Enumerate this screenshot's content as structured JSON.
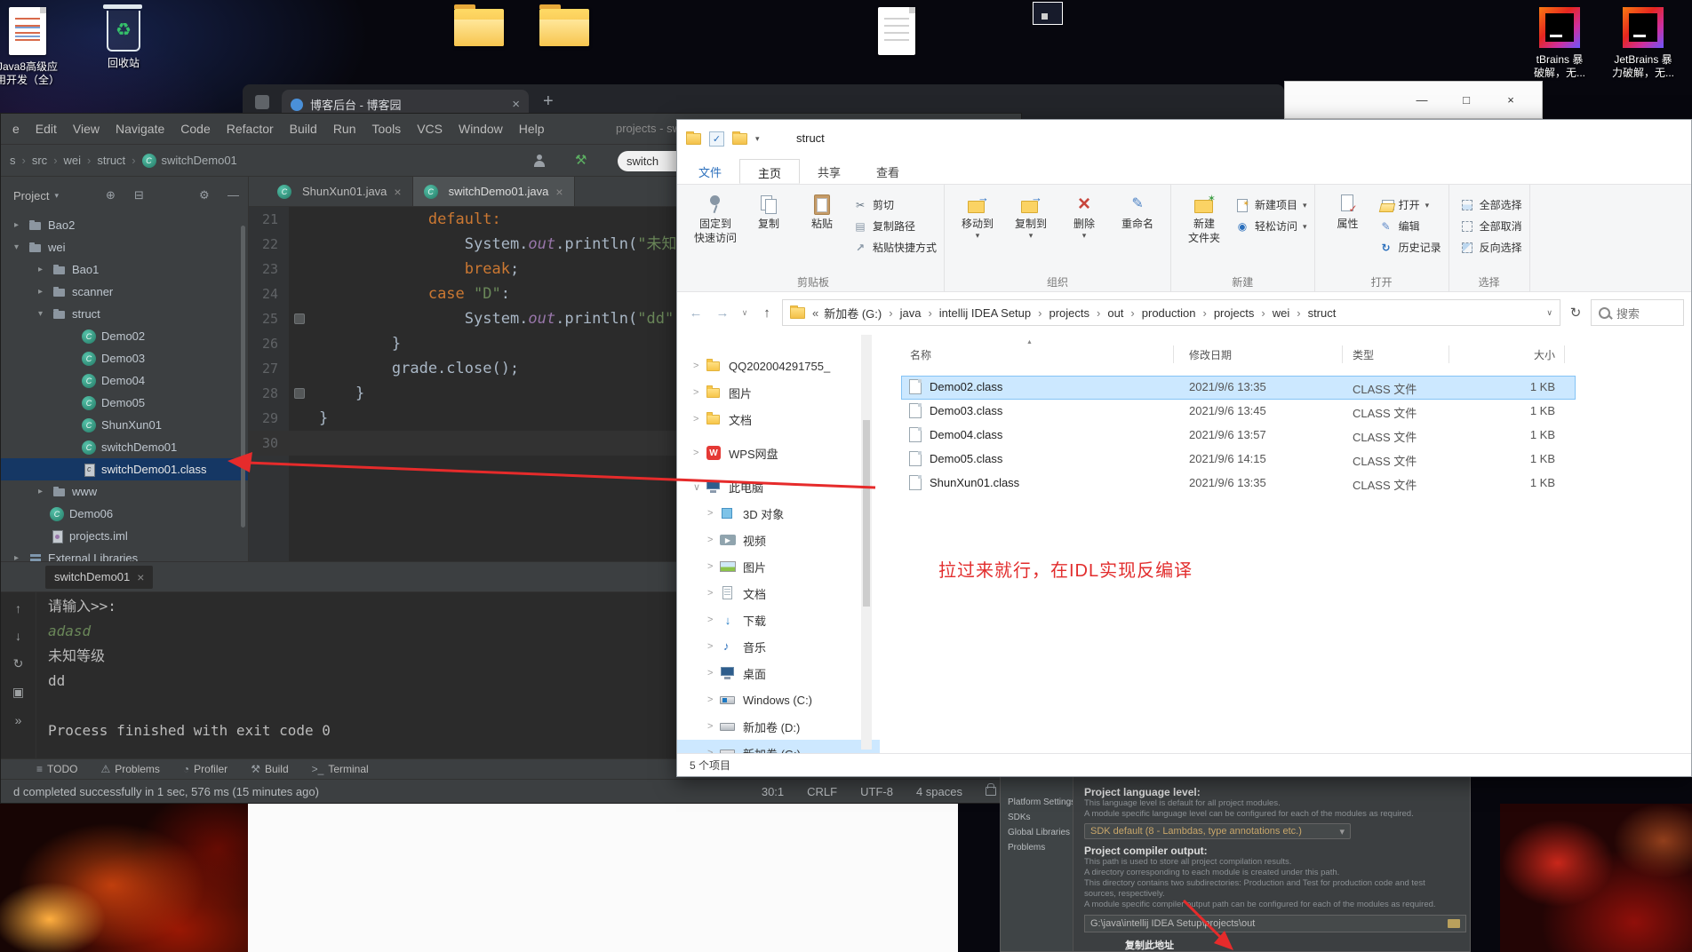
{
  "desktop": {
    "icon_java8": {
      "line1": "Java8高级应",
      "line2": "用开发（全）"
    },
    "recycle_label": "回收站",
    "jb1": {
      "line1": "tBrains 暴",
      "line2": "破解，无..."
    },
    "jb2": {
      "line1": "JetBrains 暴",
      "line2": "力破解，无..."
    }
  },
  "browser": {
    "tab_title": "博客后台 - 博客园",
    "close": "×",
    "new_tab": "+"
  },
  "bg_window": {
    "min": "—",
    "max": "□",
    "close": "×"
  },
  "idea": {
    "menu": [
      "e",
      "Edit",
      "View",
      "Navigate",
      "Code",
      "Refactor",
      "Build",
      "Run",
      "Tools",
      "VCS",
      "Window",
      "Help"
    ],
    "title": "projects - sw",
    "breadcrumbs": [
      {
        "t": "s"
      },
      {
        "t": "src"
      },
      {
        "t": "wei"
      },
      {
        "t": "struct"
      },
      {
        "t": "switchDemo01",
        "icon": true
      }
    ],
    "run_config": "switch",
    "project_label": "Project",
    "project_caret": "▾",
    "panel_icons": [
      "⊕",
      "⊟",
      "⚙",
      "—"
    ],
    "tree": [
      {
        "label": "Bao2",
        "cls": "lvl1",
        "chev": "▸",
        "icon": "folder"
      },
      {
        "label": "wei",
        "cls": "lvl1",
        "chev": "▾",
        "icon": "folder"
      },
      {
        "label": "Bao1",
        "cls": "lvl2",
        "chev": "▸",
        "icon": "folder"
      },
      {
        "label": "scanner",
        "cls": "lvl2",
        "chev": "▸",
        "icon": "folder"
      },
      {
        "label": "struct",
        "cls": "lvl2",
        "chev": "▾",
        "icon": "folder"
      },
      {
        "label": "Demo02",
        "cls": "lvl3",
        "icon": "class"
      },
      {
        "label": "Demo03",
        "cls": "lvl3",
        "icon": "class"
      },
      {
        "label": "Demo04",
        "cls": "lvl3",
        "icon": "class"
      },
      {
        "label": "Demo05",
        "cls": "lvl3",
        "icon": "class"
      },
      {
        "label": "ShunXun01",
        "cls": "lvl3",
        "icon": "class"
      },
      {
        "label": "switchDemo01",
        "cls": "lvl3",
        "icon": "class"
      },
      {
        "label": "switchDemo01.class",
        "cls": "lvl3 selected",
        "icon": "classfile"
      },
      {
        "label": "www",
        "cls": "lvl2",
        "chev": "▸",
        "icon": "folder"
      },
      {
        "label": "Demo06",
        "cls": "lvl1b",
        "icon": "class"
      },
      {
        "label": "projects.iml",
        "cls": "lvl1b",
        "icon": "iml"
      },
      {
        "label": "External Libraries",
        "cls": "lvl1",
        "chev": "▸",
        "icon": "lib"
      }
    ],
    "tabs": [
      {
        "label": "ShunXun01.java",
        "close": "×"
      },
      {
        "label": "switchDemo01.java",
        "close": "×",
        "cls": "active"
      }
    ],
    "editor_lines": [
      {
        "n": "21",
        "segs": [
          {
            "t": "            ",
            "c": "pl"
          },
          {
            "t": "default:",
            "c": "kw"
          }
        ]
      },
      {
        "n": "22",
        "segs": [
          {
            "t": "                ",
            "c": "pl"
          },
          {
            "t": "System.",
            "c": "pl"
          },
          {
            "t": "out",
            "c": "fld"
          },
          {
            "t": ".println(",
            "c": "pl"
          },
          {
            "t": "\"未知等级\"",
            "c": "str"
          },
          {
            "t": ");",
            "c": "pl"
          }
        ]
      },
      {
        "n": "23",
        "segs": [
          {
            "t": "                ",
            "c": "pl"
          },
          {
            "t": "break",
            "c": "kw"
          },
          {
            "t": ";",
            "c": "pl"
          }
        ]
      },
      {
        "n": "24",
        "segs": [
          {
            "t": "            ",
            "c": "pl"
          },
          {
            "t": "case ",
            "c": "kw"
          },
          {
            "t": "\"D\"",
            "c": "str"
          },
          {
            "t": ":",
            "c": "pl"
          }
        ]
      },
      {
        "n": "25",
        "mark": true,
        "segs": [
          {
            "t": "                ",
            "c": "pl"
          },
          {
            "t": "System.",
            "c": "pl"
          },
          {
            "t": "out",
            "c": "fld"
          },
          {
            "t": ".println(",
            "c": "pl"
          },
          {
            "t": "\"dd\"",
            "c": "str"
          },
          {
            "t": ");",
            "c": "pl"
          }
        ]
      },
      {
        "n": "26",
        "segs": [
          {
            "t": "        }",
            "c": "pl"
          }
        ]
      },
      {
        "n": "27",
        "segs": [
          {
            "t": "        grade.close();",
            "c": "pl"
          }
        ]
      },
      {
        "n": "28",
        "mark": true,
        "segs": [
          {
            "t": "    }",
            "c": "pl"
          }
        ]
      },
      {
        "n": "29",
        "segs": [
          {
            "t": "}",
            "c": "pl"
          }
        ]
      },
      {
        "n": "30",
        "cur": true,
        "segs": []
      }
    ],
    "console": {
      "tab": "switchDemo01",
      "close": "×",
      "gutter_icons": [
        "↑",
        "↓",
        "↻",
        "▣",
        "»"
      ],
      "lines": [
        {
          "t": "请输入>>:",
          "cls": "out"
        },
        {
          "t": "adasd",
          "cls": "inp"
        },
        {
          "t": "未知等级",
          "cls": "out"
        },
        {
          "t": "dd",
          "cls": "out"
        },
        {
          "t": " ",
          "cls": "out"
        },
        {
          "t": "Process finished with exit code 0",
          "cls": "out"
        }
      ]
    },
    "tool_tabs": [
      {
        "icon": "≡",
        "label": "TODO"
      },
      {
        "icon": "⚠",
        "label": "Problems"
      },
      {
        "icon": "◔",
        "label": "Profiler"
      },
      {
        "icon": "⚒",
        "label": "Build"
      },
      {
        "icon": ">_",
        "label": "Terminal"
      }
    ],
    "status": {
      "left": "d completed successfully in 1 sec, 576 ms (15 minutes ago)",
      "caret": "30:1",
      "line_sep": "CRLF",
      "encoding": "UTF-8",
      "indent": "4 spaces"
    }
  },
  "explorer": {
    "title": "struct",
    "ribbon_tabs": [
      {
        "label": "文件",
        "cls": "filetab"
      },
      {
        "label": "主页",
        "cls": "active"
      },
      {
        "label": "共享"
      },
      {
        "label": "查看"
      }
    ],
    "ribbon": {
      "labels": [
        "剪贴板",
        "组织",
        "新建",
        "打开",
        "选择"
      ],
      "clip_big": [
        {
          "l1": "固定到",
          "l2": "快速访问",
          "icon": "pin"
        },
        {
          "l1": "复制",
          "l2": "",
          "icon": "copy"
        },
        {
          "l1": "粘贴",
          "l2": "",
          "icon": "paste"
        }
      ],
      "clip_small": [
        {
          "label": "剪切",
          "icon": "cut"
        },
        {
          "label": "复制路径",
          "icon": "path"
        },
        {
          "label": "粘贴快捷方式",
          "icon": "shortcut"
        }
      ],
      "organize": [
        {
          "l1": "移动到",
          "l2": "",
          "icon": "moveto",
          "caret": true
        },
        {
          "l1": "复制到",
          "l2": "",
          "icon": "copyto",
          "caret": true
        },
        {
          "l1": "删除",
          "l2": "",
          "icon": "del",
          "caret": true
        },
        {
          "l1": "重命名",
          "l2": "",
          "icon": "ren"
        }
      ],
      "new_big": [
        {
          "l1": "新建",
          "l2": "文件夹",
          "icon": "newfolder"
        }
      ],
      "new_small": [
        {
          "label": "新建项目",
          "icon": "newitem",
          "caret": true
        },
        {
          "label": "轻松访问",
          "icon": "access",
          "caret": true
        }
      ],
      "open_big": [
        {
          "l1": "属性",
          "l2": "",
          "icon": "props"
        }
      ],
      "open_small": [
        {
          "label": "打开",
          "icon": "open",
          "caret": true
        },
        {
          "label": "编辑",
          "icon": "edit"
        },
        {
          "label": "历史记录",
          "icon": "history"
        }
      ],
      "select_small": [
        {
          "label": "全部选择",
          "icon": "selall"
        },
        {
          "label": "全部取消",
          "icon": "selnone"
        },
        {
          "label": "反向选择",
          "icon": "selinv"
        }
      ]
    },
    "address_prefix": "«",
    "address_segments": [
      "新加卷 (G:)",
      "java",
      "intellij IDEA Setup",
      "projects",
      "out",
      "production",
      "projects",
      "wei",
      "struct"
    ],
    "search_text": "搜索",
    "sidebar": [
      {
        "label": "QQ202004291755_",
        "icon": "folder",
        "cls": "lvl1",
        "chev": ">"
      },
      {
        "label": "图片",
        "icon": "folder",
        "cls": "lvl1",
        "chev": ">"
      },
      {
        "label": "文档",
        "icon": "folder",
        "cls": "lvl1",
        "chev": ">"
      },
      {
        "label": "WPS网盘",
        "icon": "wps",
        "cls": "lvl1 gap",
        "chev": ">"
      },
      {
        "label": "此电脑",
        "icon": "pc",
        "cls": "lvl1 gap",
        "chev": "∨"
      },
      {
        "label": "3D 对象",
        "icon": "box3d",
        "cls": "lvl2",
        "chev": ">"
      },
      {
        "label": "视频",
        "icon": "video",
        "cls": "lvl2",
        "chev": ">"
      },
      {
        "label": "图片",
        "icon": "pic",
        "cls": "lvl2",
        "chev": ">"
      },
      {
        "label": "文档",
        "icon": "doc",
        "cls": "lvl2",
        "chev": ">"
      },
      {
        "label": "下载",
        "icon": "down",
        "cls": "lvl2",
        "chev": ">"
      },
      {
        "label": "音乐",
        "icon": "music",
        "cls": "lvl2",
        "chev": ">"
      },
      {
        "label": "桌面",
        "icon": "desk",
        "cls": "lvl2",
        "chev": ">"
      },
      {
        "label": "Windows (C:)",
        "icon": "drivec",
        "cls": "lvl2",
        "chev": ">"
      },
      {
        "label": "新加卷 (D:)",
        "icon": "drive",
        "cls": "lvl2",
        "chev": ">"
      },
      {
        "label": "新加卷 (G:)",
        "icon": "drive",
        "cls": "lvl2 current",
        "chev": ">"
      }
    ],
    "columns": [
      "名称",
      "修改日期",
      "类型",
      "大小"
    ],
    "files": [
      {
        "name": "Demo02.class",
        "date": "2021/9/6 13:35",
        "type": "CLASS 文件",
        "size": "1 KB",
        "cls": "selected"
      },
      {
        "name": "Demo03.class",
        "date": "2021/9/6 13:45",
        "type": "CLASS 文件",
        "size": "1 KB"
      },
      {
        "name": "Demo04.class",
        "date": "2021/9/6 13:57",
        "type": "CLASS 文件",
        "size": "1 KB"
      },
      {
        "name": "Demo05.class",
        "date": "2021/9/6 14:15",
        "type": "CLASS 文件",
        "size": "1 KB"
      },
      {
        "name": "ShunXun01.class",
        "date": "2021/9/6 13:35",
        "type": "CLASS 文件",
        "size": "1 KB"
      }
    ],
    "status": "5 个项目"
  },
  "settings": {
    "nav": [
      "Platform Settings",
      "SDKs",
      "Global Libraries",
      "Problems"
    ],
    "lang_label": "Project language level:",
    "lang_desc1": "This language level is default for all project modules.",
    "lang_desc2": "A module specific language level can be configured for each of the modules as required.",
    "sdk_default": "SDK default (8 - Lambdas, type annotations etc.)",
    "sdk_caret": "▾",
    "out_label": "Project compiler output:",
    "out_desc1": "This path is used to store all project compilation results.",
    "out_desc2": "A directory corresponding to each module is created under this path.",
    "out_desc3": "This directory contains two subdirectories: Production and Test for production code and test sources, respectively.",
    "out_desc4": "A module specific compiler output path can be configured for each of the modules as required.",
    "out_path": "G:\\java\\intellij IDEA Setup\\projects\\out",
    "footer": "复制此地址"
  },
  "annotations": {
    "note": "拉过来就行，在IDL实现反编译"
  }
}
